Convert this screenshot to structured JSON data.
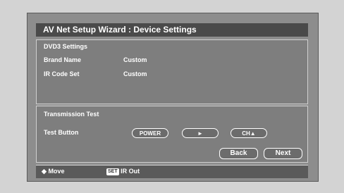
{
  "title": "AV Net Setup Wizard : Device Settings",
  "settings": {
    "heading": "DVD3 Settings",
    "brand_label": "Brand Name",
    "brand_value": "Custom",
    "ir_label": "IR Code Set",
    "ir_value": "Custom"
  },
  "test": {
    "heading": "Transmission Test",
    "button_label": "Test Button",
    "power": "POWER",
    "play": "►",
    "ch_up": "CH▲"
  },
  "nav": {
    "back": "Back",
    "next": "Next"
  },
  "footer": {
    "move_icon": "◆",
    "move": "Move",
    "set_badge": "SET",
    "ir_out": "IR Out"
  }
}
